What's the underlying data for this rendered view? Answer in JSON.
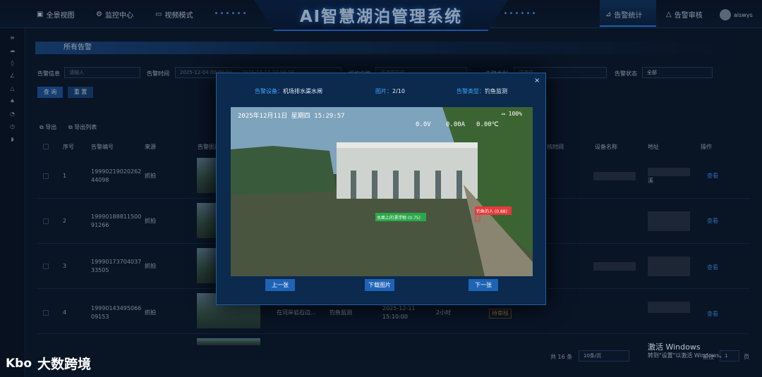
{
  "header": {
    "nav_overview": "全景视图",
    "nav_monitor": "监控中心",
    "nav_video": "视频模式",
    "title": "AI智慧湖泊管理系统",
    "nav_stats": "告警统计",
    "nav_review": "告警审核",
    "user": "aiswys"
  },
  "page": {
    "title": "所有告警"
  },
  "filters": {
    "info_label": "告警信息",
    "info_placeholder": "请输入",
    "time_label": "告警时间",
    "time_start": "2025-12-04 00:00:00",
    "time_end": "2025-12-11 23:59:59",
    "org_label": "机构名称",
    "org_placeholder": "请选择机构",
    "type_label": "告警类别",
    "type_placeholder": "请选择",
    "status_label": "告警状态",
    "status_value": "全部",
    "search": "查 询",
    "reset": "重 置"
  },
  "actions": {
    "export": "导出",
    "export_list": "导出列表"
  },
  "table": {
    "headers": [
      "序号",
      "告警编号",
      "来源",
      "告警图片",
      "审核时间",
      "设备名称",
      "地址",
      "操作"
    ],
    "rows": [
      {
        "no": "1",
        "code1": "19990219020262",
        "code2": "44098",
        "source": "抓拍",
        "view": "查看",
        "addr": "溪"
      },
      {
        "no": "2",
        "code1": "19990188811500",
        "code2": "91266",
        "source": "抓拍",
        "view": "查看",
        "addr": ""
      },
      {
        "no": "3",
        "code1": "19990173704037",
        "code2": "33505",
        "source": "抓拍",
        "view": "查看",
        "addr": ""
      },
      {
        "no": "4",
        "code1": "19990143495066",
        "code2": "09153",
        "source": "抓拍",
        "view": "查看",
        "addr": "",
        "desc": "在河岸岩石边...",
        "type": "钓鱼监测",
        "date": "2025-12-11",
        "time": "15:10:00",
        "duration": "2小时",
        "status": "待审核"
      }
    ]
  },
  "pagination": {
    "total": "共 16 条",
    "per_page": "10条/页",
    "goto": "前往",
    "page": "1",
    "unit": "页"
  },
  "modal": {
    "device_label": "告警设备：",
    "device": "机场排水渠水闸",
    "image_label": "图片：",
    "image": "2/10",
    "type_label": "告警类型：",
    "type": "钓鱼监测",
    "prev": "上一张",
    "download": "下载图片",
    "next": "下一张",
    "close": "×"
  },
  "photo": {
    "timestamp": "2025年12月11日  星期四  15:29:57",
    "battery": "100%",
    "v": "0.0V",
    "a": "0.00A",
    "t": "0.00℃",
    "det1": "水面上的漂浮物 (0.75)",
    "det2": "钓鱼的人 (0.88)"
  },
  "watermark": {
    "line1": "激活 Windows",
    "line2": "转到\"设置\"以激活 Windows。"
  },
  "brand": {
    "name": "大数跨境",
    "logo": "Kbo"
  }
}
